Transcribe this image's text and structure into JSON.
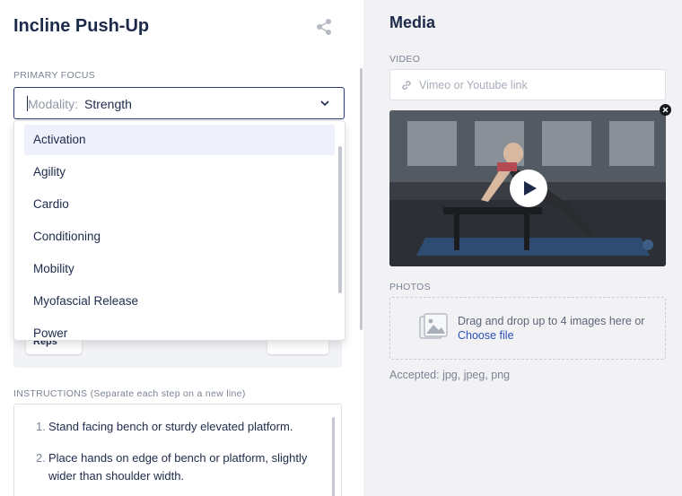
{
  "exercise": {
    "title": "Incline Push-Up"
  },
  "primary_focus": {
    "label": "PRIMARY FOCUS",
    "prefix": "Modality:",
    "value": "Strength",
    "options": [
      "Activation",
      "Agility",
      "Cardio",
      "Conditioning",
      "Mobility",
      "Myofascial Release",
      "Power"
    ],
    "highlighted": "Activation"
  },
  "reps": {
    "chip_label": "Reps",
    "control": "+"
  },
  "instructions": {
    "label": "INSTRUCTIONS (Separate each step on a new line)",
    "steps": [
      {
        "num": "1.",
        "text": "Stand facing bench or sturdy elevated platform."
      },
      {
        "num": "2.",
        "text": "Place hands on edge of bench or platform, slightly wider than shoulder width."
      }
    ]
  },
  "media": {
    "title": "Media",
    "video_label": "VIDEO",
    "video_placeholder": "Vimeo or Youtube link",
    "photos_label": "PHOTOS",
    "dropzone_text": "Drag and drop up to 4 images here or",
    "dropzone_link": "Choose file",
    "accepted": "Accepted: jpg, jpeg, png"
  },
  "colors": {
    "accent": "#2a3a73",
    "link": "#2a4fb8",
    "text": "#1d2a4a"
  }
}
